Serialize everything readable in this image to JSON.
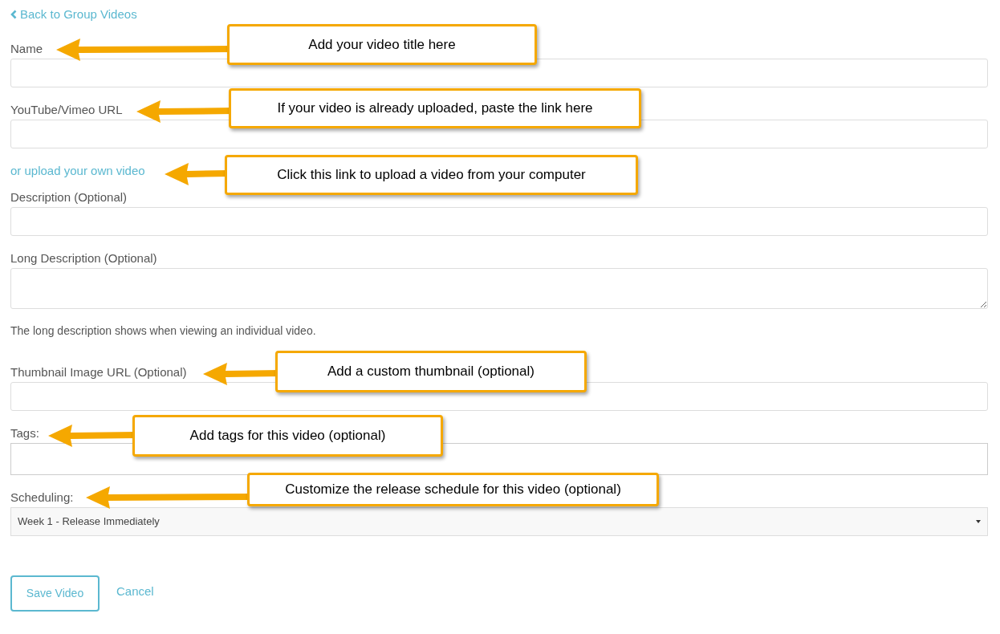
{
  "back_link": {
    "text": "Back to Group Videos"
  },
  "form_items": [
    {
      "kind": "field",
      "label": "Name",
      "callout": "Add your video title here"
    },
    {
      "kind": "field",
      "label": "YouTube/Vimeo URL",
      "callout": "If your video is already uploaded, paste the link here"
    },
    {
      "kind": "link",
      "text": "or upload your own video",
      "callout": "Click this link to upload a video from your computer"
    },
    {
      "kind": "field",
      "label": "Description (Optional)"
    },
    {
      "kind": "textarea",
      "label": "Long Description (Optional)"
    },
    {
      "kind": "help",
      "text": "The long description shows when viewing an individual video."
    },
    {
      "kind": "field",
      "label": "Thumbnail Image URL (Optional)",
      "callout": "Add a custom thumbnail (optional)"
    },
    {
      "kind": "tags",
      "label": "Tags:",
      "callout": "Add tags for this video (optional)"
    },
    {
      "kind": "select",
      "label": "Scheduling:",
      "value": "Week 1 - Release Immediately",
      "callout": "Customize the release schedule for this video (optional)"
    }
  ],
  "buttons": {
    "save": "Save Video",
    "cancel": "Cancel"
  }
}
